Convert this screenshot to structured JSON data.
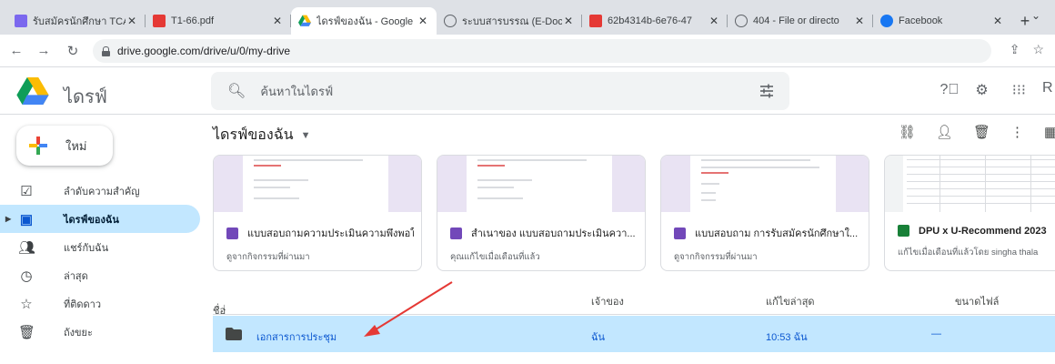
{
  "browser": {
    "tabs": [
      {
        "title": "รับสมัครนักศึกษา TCA",
        "favicon": "tca-favicon",
        "color": "#7b68ee",
        "active": false
      },
      {
        "title": "T1-66.pdf",
        "favicon": "pdf-icon",
        "color": "#e53935",
        "active": false
      },
      {
        "title": "ไดรฟ์ของฉัน - Google",
        "favicon": "google-drive-icon",
        "color": "#1e88e5",
        "active": true
      },
      {
        "title": "ระบบสารบรรณ (E-Doc",
        "favicon": "globe-icon",
        "color": "#5f6368",
        "active": false
      },
      {
        "title": "62b4314b-6e76-47",
        "favicon": "pdf-icon",
        "color": "#e53935",
        "active": false
      },
      {
        "title": "404 - File or directo",
        "favicon": "globe-icon",
        "color": "#5f6368",
        "active": false
      },
      {
        "title": "Facebook",
        "favicon": "facebook-icon",
        "color": "#1877f2",
        "active": false
      }
    ],
    "url": "drive.google.com/drive/u/0/my-drive"
  },
  "drive": {
    "brand": "ไดรฟ์",
    "search_placeholder": "ค้นหาในไดรฟ์",
    "avatar_initial": "R",
    "new_label": "ใหม่",
    "nav": [
      {
        "label": "ลำดับความสำคัญ",
        "icon": "priority-icon",
        "active": false
      },
      {
        "label": "ไดรฟ์ของฉัน",
        "icon": "my-drive-icon",
        "active": true
      },
      {
        "label": "แชร์กับฉัน",
        "icon": "shared-icon",
        "active": false
      },
      {
        "label": "ล่าสุด",
        "icon": "clock-icon",
        "active": false
      },
      {
        "label": "ที่ติดดาว",
        "icon": "star-icon",
        "active": false
      },
      {
        "label": "ถังขยะ",
        "icon": "trash-icon",
        "active": false
      }
    ],
    "breadcrumb": "ไดรฟ์ของฉัน",
    "suggested": [
      {
        "name": "แบบสอบถามความประเมินความพึงพอใจห...",
        "activity": "ดูจากกิจกรรมที่ผ่านมา",
        "type": "forms",
        "color": "#7248b9"
      },
      {
        "name": "สำเนาของ แบบสอบถามประเมินควา...",
        "activity": "คุณแก้ไขเมื่อเดือนที่แล้ว",
        "type": "forms",
        "color": "#7248b9"
      },
      {
        "name": "แบบสอบถาม การรับสมัครนักศึกษาใ...",
        "activity": "ดูจากกิจกรรมที่ผ่านมา",
        "type": "forms",
        "color": "#7248b9"
      },
      {
        "name": "DPU x U-Recommend 2023",
        "activity": "แก้ไขเมื่อเดือนที่แล้วโดย singha thala",
        "type": "sheets",
        "color": "#188038"
      }
    ],
    "columns": {
      "name": "ชื่อ",
      "owner": "เจ้าของ",
      "modified": "แก้ไขล่าสุด",
      "size": "ขนาดไฟล์"
    },
    "files": [
      {
        "name": "เอกสารการประชุม",
        "owner": "ฉัน",
        "modified": "10:53 ฉัน",
        "size": "—",
        "type": "folder"
      }
    ]
  },
  "colors": {
    "accent": "#0b57d0",
    "selection": "#c2e7ff",
    "annotation_arrow": "#e53935"
  }
}
